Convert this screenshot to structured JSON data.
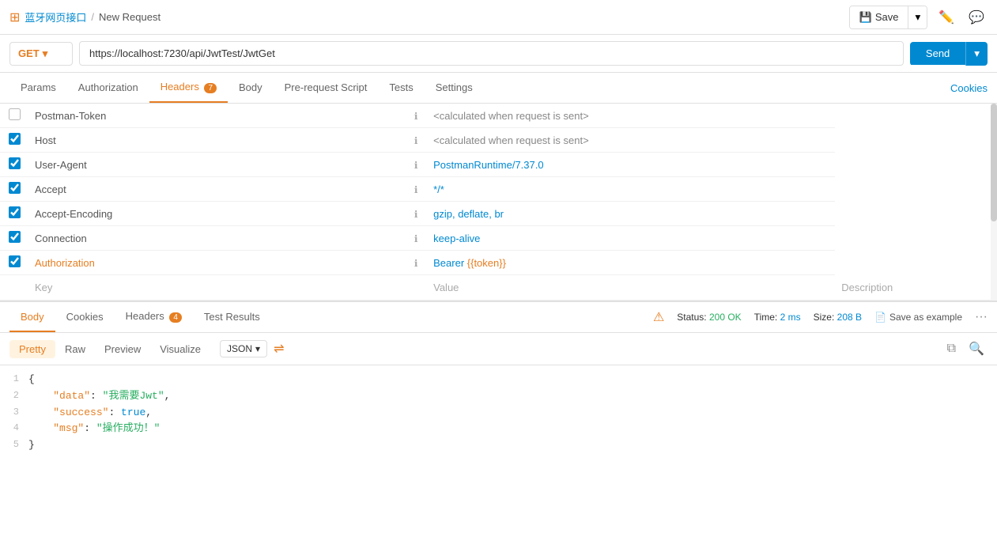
{
  "topBar": {
    "appIcon": "grid-icon",
    "appName": "蓝牙网页接口",
    "separator": "/",
    "currentPage": "New Request",
    "saveLabel": "Save",
    "editIcon": "edit-icon",
    "commentIcon": "comment-icon"
  },
  "urlBar": {
    "method": "GET",
    "url": "https://localhost:7230/api/JwtTest/JwtGet",
    "sendLabel": "Send"
  },
  "requestTabs": {
    "items": [
      {
        "label": "Params",
        "active": false,
        "badge": null
      },
      {
        "label": "Authorization",
        "active": false,
        "badge": null
      },
      {
        "label": "Headers",
        "active": true,
        "badge": "7"
      },
      {
        "label": "Body",
        "active": false,
        "badge": null
      },
      {
        "label": "Pre-request Script",
        "active": false,
        "badge": null
      },
      {
        "label": "Tests",
        "active": false,
        "badge": null
      },
      {
        "label": "Settings",
        "active": false,
        "badge": null
      }
    ],
    "cookiesLink": "Cookies"
  },
  "headers": {
    "columns": {
      "key": "Key",
      "value": "Value",
      "description": "Description"
    },
    "rows": [
      {
        "checked": false,
        "disabled": true,
        "key": "Postman-Token",
        "value": "<calculated when request is sent>",
        "valueClass": "gray"
      },
      {
        "checked": true,
        "disabled": false,
        "key": "Host",
        "value": "<calculated when request is sent>",
        "valueClass": "gray"
      },
      {
        "checked": true,
        "disabled": false,
        "key": "User-Agent",
        "value": "PostmanRuntime/7.37.0",
        "valueClass": "normal"
      },
      {
        "checked": true,
        "disabled": false,
        "key": "Accept",
        "value": "*/*",
        "valueClass": "normal"
      },
      {
        "checked": true,
        "disabled": false,
        "key": "Accept-Encoding",
        "value": "gzip, deflate, br",
        "valueClass": "normal"
      },
      {
        "checked": true,
        "disabled": false,
        "key": "Connection",
        "value": "keep-alive",
        "valueClass": "normal"
      },
      {
        "checked": true,
        "disabled": false,
        "key": "Authorization",
        "value": "Bearer {{token}}",
        "valueClass": "auth",
        "keyClass": "orange"
      }
    ]
  },
  "responseTabs": {
    "items": [
      {
        "label": "Body",
        "active": true
      },
      {
        "label": "Cookies",
        "active": false
      },
      {
        "label": "Headers",
        "active": false,
        "badge": "4"
      },
      {
        "label": "Test Results",
        "active": false
      }
    ]
  },
  "responseStatus": {
    "statusLabel": "Status:",
    "statusValue": "200 OK",
    "timeLabel": "Time:",
    "timeValue": "2 ms",
    "sizeLabel": "Size:",
    "sizeValue": "208 B",
    "saveExample": "Save as example"
  },
  "formatTabs": {
    "items": [
      {
        "label": "Pretty",
        "active": true
      },
      {
        "label": "Raw",
        "active": false
      },
      {
        "label": "Preview",
        "active": false
      },
      {
        "label": "Visualize",
        "active": false
      }
    ],
    "jsonSelect": "JSON"
  },
  "responseBody": {
    "lines": [
      {
        "num": 1,
        "content": "{",
        "type": "brace"
      },
      {
        "num": 2,
        "key": "data",
        "value": "我需要Jwt",
        "type": "string"
      },
      {
        "num": 3,
        "key": "success",
        "value": "true",
        "type": "bool"
      },
      {
        "num": 4,
        "key": "msg",
        "value": "操作成功！",
        "type": "string"
      },
      {
        "num": 5,
        "content": "}",
        "type": "brace"
      }
    ]
  }
}
